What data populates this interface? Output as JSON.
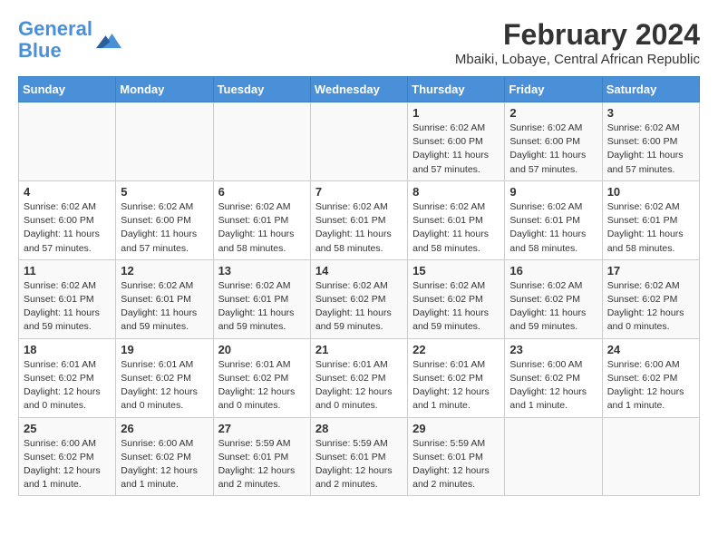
{
  "logo": {
    "line1": "General",
    "line2": "Blue"
  },
  "title": "February 2024",
  "location": "Mbaiki, Lobaye, Central African Republic",
  "header": {
    "days": [
      "Sunday",
      "Monday",
      "Tuesday",
      "Wednesday",
      "Thursday",
      "Friday",
      "Saturday"
    ]
  },
  "weeks": [
    [
      {
        "day": "",
        "info": ""
      },
      {
        "day": "",
        "info": ""
      },
      {
        "day": "",
        "info": ""
      },
      {
        "day": "",
        "info": ""
      },
      {
        "day": "1",
        "info": "Sunrise: 6:02 AM\nSunset: 6:00 PM\nDaylight: 11 hours\nand 57 minutes."
      },
      {
        "day": "2",
        "info": "Sunrise: 6:02 AM\nSunset: 6:00 PM\nDaylight: 11 hours\nand 57 minutes."
      },
      {
        "day": "3",
        "info": "Sunrise: 6:02 AM\nSunset: 6:00 PM\nDaylight: 11 hours\nand 57 minutes."
      }
    ],
    [
      {
        "day": "4",
        "info": "Sunrise: 6:02 AM\nSunset: 6:00 PM\nDaylight: 11 hours\nand 57 minutes."
      },
      {
        "day": "5",
        "info": "Sunrise: 6:02 AM\nSunset: 6:00 PM\nDaylight: 11 hours\nand 57 minutes."
      },
      {
        "day": "6",
        "info": "Sunrise: 6:02 AM\nSunset: 6:01 PM\nDaylight: 11 hours\nand 58 minutes."
      },
      {
        "day": "7",
        "info": "Sunrise: 6:02 AM\nSunset: 6:01 PM\nDaylight: 11 hours\nand 58 minutes."
      },
      {
        "day": "8",
        "info": "Sunrise: 6:02 AM\nSunset: 6:01 PM\nDaylight: 11 hours\nand 58 minutes."
      },
      {
        "day": "9",
        "info": "Sunrise: 6:02 AM\nSunset: 6:01 PM\nDaylight: 11 hours\nand 58 minutes."
      },
      {
        "day": "10",
        "info": "Sunrise: 6:02 AM\nSunset: 6:01 PM\nDaylight: 11 hours\nand 58 minutes."
      }
    ],
    [
      {
        "day": "11",
        "info": "Sunrise: 6:02 AM\nSunset: 6:01 PM\nDaylight: 11 hours\nand 59 minutes."
      },
      {
        "day": "12",
        "info": "Sunrise: 6:02 AM\nSunset: 6:01 PM\nDaylight: 11 hours\nand 59 minutes."
      },
      {
        "day": "13",
        "info": "Sunrise: 6:02 AM\nSunset: 6:01 PM\nDaylight: 11 hours\nand 59 minutes."
      },
      {
        "day": "14",
        "info": "Sunrise: 6:02 AM\nSunset: 6:02 PM\nDaylight: 11 hours\nand 59 minutes."
      },
      {
        "day": "15",
        "info": "Sunrise: 6:02 AM\nSunset: 6:02 PM\nDaylight: 11 hours\nand 59 minutes."
      },
      {
        "day": "16",
        "info": "Sunrise: 6:02 AM\nSunset: 6:02 PM\nDaylight: 11 hours\nand 59 minutes."
      },
      {
        "day": "17",
        "info": "Sunrise: 6:02 AM\nSunset: 6:02 PM\nDaylight: 12 hours\nand 0 minutes."
      }
    ],
    [
      {
        "day": "18",
        "info": "Sunrise: 6:01 AM\nSunset: 6:02 PM\nDaylight: 12 hours\nand 0 minutes."
      },
      {
        "day": "19",
        "info": "Sunrise: 6:01 AM\nSunset: 6:02 PM\nDaylight: 12 hours\nand 0 minutes."
      },
      {
        "day": "20",
        "info": "Sunrise: 6:01 AM\nSunset: 6:02 PM\nDaylight: 12 hours\nand 0 minutes."
      },
      {
        "day": "21",
        "info": "Sunrise: 6:01 AM\nSunset: 6:02 PM\nDaylight: 12 hours\nand 0 minutes."
      },
      {
        "day": "22",
        "info": "Sunrise: 6:01 AM\nSunset: 6:02 PM\nDaylight: 12 hours\nand 1 minute."
      },
      {
        "day": "23",
        "info": "Sunrise: 6:00 AM\nSunset: 6:02 PM\nDaylight: 12 hours\nand 1 minute."
      },
      {
        "day": "24",
        "info": "Sunrise: 6:00 AM\nSunset: 6:02 PM\nDaylight: 12 hours\nand 1 minute."
      }
    ],
    [
      {
        "day": "25",
        "info": "Sunrise: 6:00 AM\nSunset: 6:02 PM\nDaylight: 12 hours\nand 1 minute."
      },
      {
        "day": "26",
        "info": "Sunrise: 6:00 AM\nSunset: 6:02 PM\nDaylight: 12 hours\nand 1 minute."
      },
      {
        "day": "27",
        "info": "Sunrise: 5:59 AM\nSunset: 6:01 PM\nDaylight: 12 hours\nand 2 minutes."
      },
      {
        "day": "28",
        "info": "Sunrise: 5:59 AM\nSunset: 6:01 PM\nDaylight: 12 hours\nand 2 minutes."
      },
      {
        "day": "29",
        "info": "Sunrise: 5:59 AM\nSunset: 6:01 PM\nDaylight: 12 hours\nand 2 minutes."
      },
      {
        "day": "",
        "info": ""
      },
      {
        "day": "",
        "info": ""
      }
    ]
  ]
}
